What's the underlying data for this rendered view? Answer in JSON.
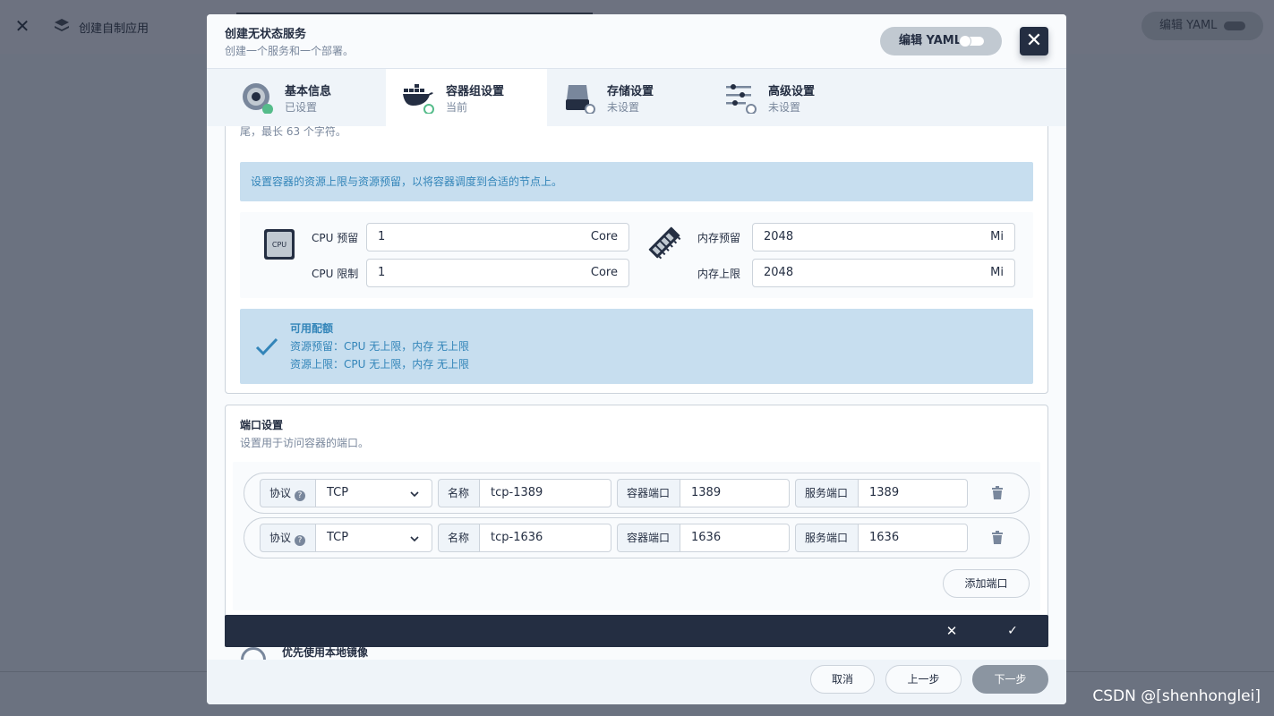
{
  "background": {
    "title": "创建自制应用",
    "yaml_label": "编辑 YAML"
  },
  "watermark": "CSDN @[shenhonglei]",
  "modal": {
    "title": "创建无状态服务",
    "description": "创建一个服务和一个部署。",
    "yaml_toggle_label": "编辑 YAML",
    "close_icon": "close-icon"
  },
  "steps": [
    {
      "title": "基本信息",
      "status": "已设置",
      "icon": "info-disc-icon",
      "state": "done"
    },
    {
      "title": "容器组设置",
      "status": "当前",
      "icon": "docker-icon",
      "state": "current"
    },
    {
      "title": "存储设置",
      "status": "未设置",
      "icon": "storage-icon",
      "state": "pending"
    },
    {
      "title": "高级设置",
      "status": "未设置",
      "icon": "sliders-icon",
      "state": "pending"
    }
  ],
  "container": {
    "cut_hint": "尾，最长 63 个字符。",
    "resource_info": "设置容器的资源上限与资源预留，以将容器调度到合适的节点上。",
    "cpu": {
      "icon_text": "CPU",
      "request_label": "CPU 预留",
      "request_value": "1",
      "limit_label": "CPU 限制",
      "limit_value": "1",
      "unit": "Core"
    },
    "memory": {
      "request_label": "内存预留",
      "request_value": "2048",
      "limit_label": "内存上限",
      "limit_value": "2048",
      "unit": "Mi"
    },
    "quota": {
      "title": "可用配额",
      "line1": "资源预留：CPU 无上限，内存 无上限",
      "line2": "资源上限：CPU 无上限，内存 无上限"
    }
  },
  "ports": {
    "title": "端口设置",
    "description": "设置用于访问容器的端口。",
    "protocol_label": "协议",
    "help_glyph": "?",
    "name_label": "名称",
    "container_port_label": "容器端口",
    "service_port_label": "服务端口",
    "rows": [
      {
        "protocol": "TCP",
        "name": "tcp-1389",
        "container_port": "1389",
        "service_port": "1389"
      },
      {
        "protocol": "TCP",
        "name": "tcp-1636",
        "container_port": "1636",
        "service_port": "1636"
      }
    ],
    "add_label": "添加端口"
  },
  "confirm_bar": {
    "cancel_glyph": "✕",
    "ok_glyph": "✓"
  },
  "below_text": "优先使用本地镜像",
  "footer": {
    "cancel": "取消",
    "prev": "上一步",
    "next": "下一步"
  },
  "colors": {
    "dark": "#242e42",
    "info_bg": "#c7deef",
    "info_text": "#3385b9",
    "done_green": "#55bc8a"
  }
}
